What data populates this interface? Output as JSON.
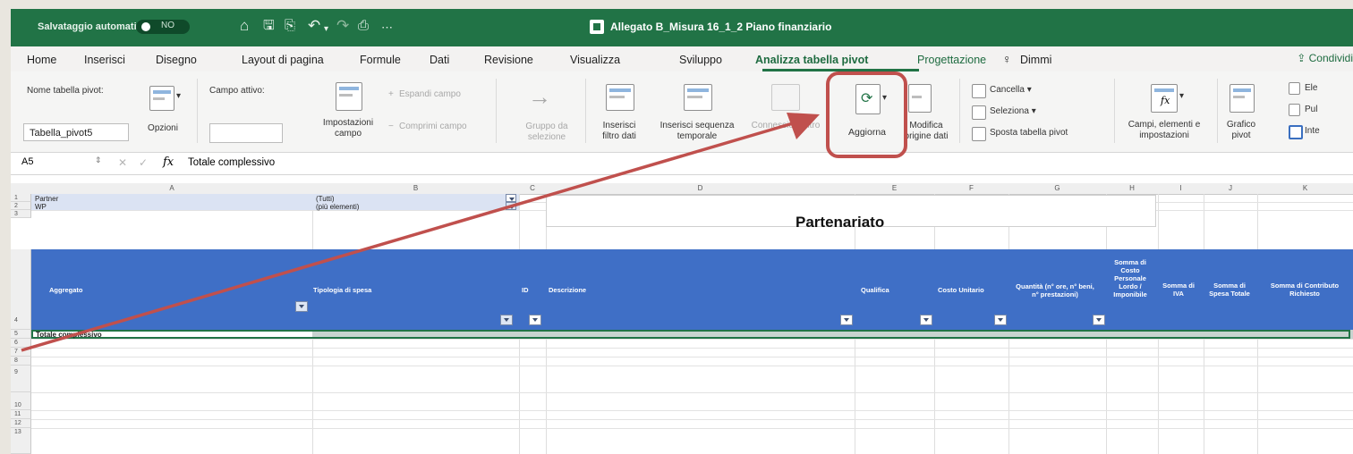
{
  "titlebar": {
    "autosave_label": "Salvataggio automatico",
    "toggle_state": "NO",
    "doc_title": "Allegato B_Misura 16_1_2 Piano finanziario"
  },
  "tabs": [
    "Home",
    "Inserisci",
    "Disegno",
    "Layout di pagina",
    "Formule",
    "Dati",
    "Revisione",
    "Visualizza",
    "Sviluppo",
    "Analizza tabella pivot",
    "Progettazione",
    "Dimmi"
  ],
  "share_label": "Condividi",
  "ribbon": {
    "pivot_name_label": "Nome tabella pivot:",
    "pivot_name_value": "Tabella_pivot5",
    "options": "Opzioni",
    "active_field_label": "Campo attivo:",
    "field_settings": "Impostazioni campo",
    "expand_field": "Espandi campo",
    "collapse_field": "Comprimi campo",
    "group_selection": "Gruppo da selezione",
    "insert_slicer": "Inserisci filtro dati",
    "insert_timeline": "Inserisci sequenza temporale",
    "filter_connections": "Connessioni filtro",
    "refresh": "Aggiorna",
    "change_source": "Modifica origine dati",
    "clear": "Cancella",
    "select": "Seleziona",
    "move_pivot": "Sposta tabella pivot",
    "fields_items": "Campi, elementi e impostazioni",
    "pivot_chart": "Grafico pivot",
    "right_1": "Ele",
    "right_2": "Pul",
    "right_3": "Inte"
  },
  "formula": {
    "namebox": "A5",
    "fx": "fx",
    "content": "Totale complessivo"
  },
  "columns": [
    "A",
    "B",
    "C",
    "D",
    "E",
    "F",
    "G",
    "H",
    "I",
    "J",
    "K"
  ],
  "rows": [
    "1",
    "2",
    "3",
    "4",
    "5",
    "6",
    "7",
    "8",
    "9",
    "10",
    "11",
    "12",
    "13"
  ],
  "sheet": {
    "partner_label": "Partner",
    "partner_value": "(Tutti)",
    "wp_label": "WP",
    "wp_value": "(più elementi)",
    "heading": "Partenariato",
    "headers": {
      "aggregato": "Aggregato",
      "tipologia": "Tipologia di spesa",
      "id": "ID",
      "descrizione": "Descrizione",
      "qualifica": "Qualifica",
      "costo_unitario": "Costo Unitario",
      "quantita": "Quantità (n° ore, n° beni, n° prestazioni)",
      "somma_costo": "Somma di Costo Personale Lordo / Imponibile",
      "iva": "Somma di IVA",
      "spesa_totale": "Somma di Spesa Totale",
      "contributo": "Somma di Contributo Richiesto"
    },
    "total_row": "Totale complessivo"
  },
  "colors": {
    "excel_green": "#217346",
    "pivot_header_blue": "#3F6FC6",
    "annotation_red": "#C0504D"
  }
}
